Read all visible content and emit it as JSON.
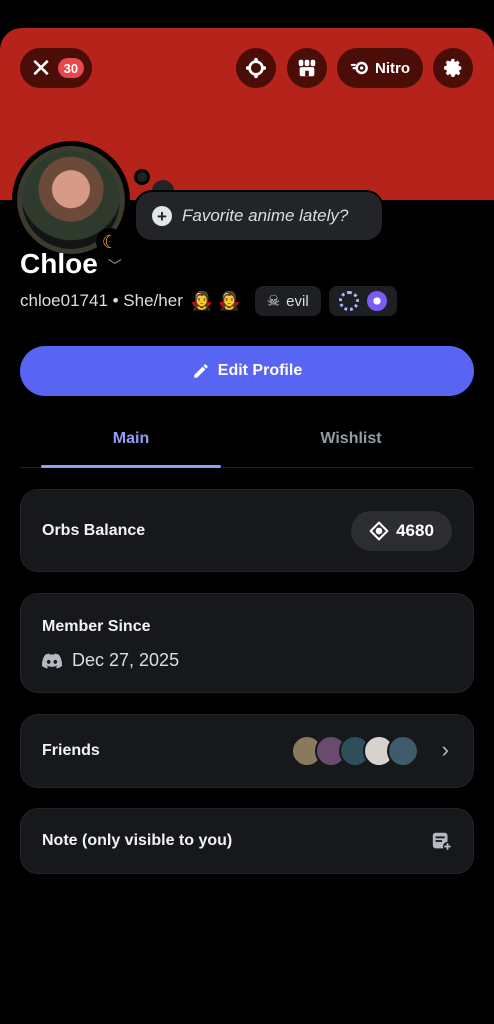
{
  "header": {
    "close_badge_count": "30",
    "nitro_label": "Nitro"
  },
  "status_bubble": {
    "placeholder": "Favorite anime lately?"
  },
  "profile": {
    "display_name": "Chloe",
    "username_line": "chloe01741 • She/her",
    "emojis": "🧛‍♀️ 🧛‍♀️",
    "tag_label": "evil",
    "edit_profile_label": "Edit Profile"
  },
  "tabs": [
    {
      "label": "Main",
      "active": true
    },
    {
      "label": "Wishlist",
      "active": false
    }
  ],
  "orbs": {
    "title": "Orbs Balance",
    "value": "4680"
  },
  "member_since": {
    "title": "Member Since",
    "date": "Dec 27, 2025"
  },
  "friends": {
    "title": "Friends",
    "avatar_colors": [
      "#8a7a5c",
      "#6a4a6e",
      "#2c4f5a",
      "#d8d2cc",
      "#3e5a6b"
    ]
  },
  "note": {
    "title": "Note (only visible to you)"
  },
  "colors": {
    "banner": "#b5231a",
    "accent": "#5865f2",
    "active_tab": "#949cf7"
  }
}
